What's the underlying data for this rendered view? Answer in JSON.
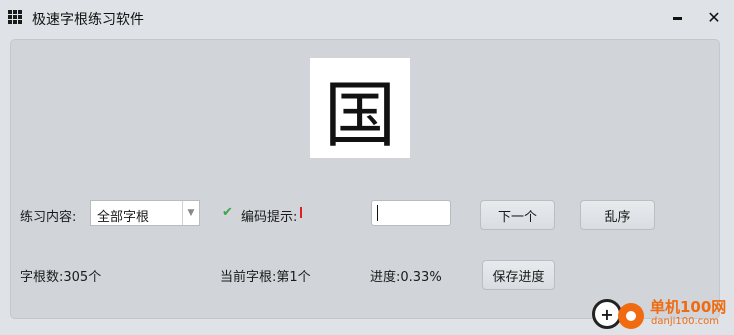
{
  "window": {
    "title": "极速字根练习软件",
    "minimize_label": "",
    "close_label": "✕"
  },
  "display": {
    "character": "国"
  },
  "controls": {
    "content_label": "练习内容:",
    "content_select_value": "全部字根",
    "hint_label": "编码提示:",
    "hint_checked": true,
    "input_value": "",
    "next_button": "下一个",
    "shuffle_button": "乱序",
    "save_button": "保存进度"
  },
  "status": {
    "radical_count": "字根数:305个",
    "current_radical": "当前字根:第1个",
    "progress": "进度:0.33%"
  },
  "watermark": {
    "site_name": "单机100网",
    "site_url": "danji100.com"
  }
}
